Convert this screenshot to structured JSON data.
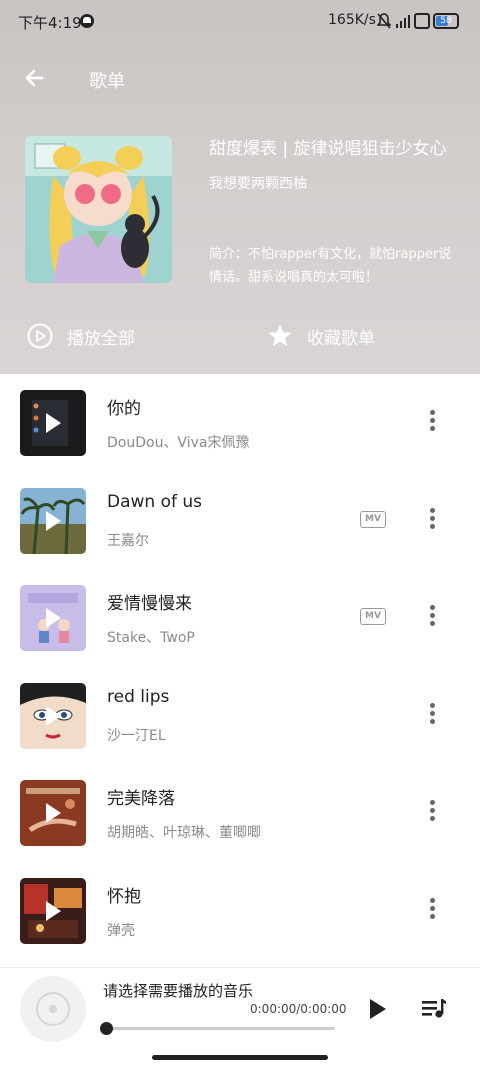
{
  "status_bar": {
    "time": "下午4:19",
    "net_speed": "165K/s",
    "battery": "58"
  },
  "header": {
    "title": "歌单",
    "back_icon": "arrow-left-icon"
  },
  "playlist": {
    "title": "甜度爆表 | 旋律说唱狙击少女心",
    "author": "我想要两颗西柚",
    "description": "简介：不怕rapper有文化，就怕rapper说情话。甜系说唱真的太可啦！"
  },
  "actions": {
    "play_all": "播放全部",
    "favorite": "收藏歌单"
  },
  "songs": [
    {
      "title": "你的",
      "artist": "DouDou、Viva宋佩豫",
      "mv": false
    },
    {
      "title": "Dawn of us",
      "artist": "王嘉尔",
      "mv": true
    },
    {
      "title": "爱情慢慢来",
      "artist": "Stake、TwoP",
      "mv": true
    },
    {
      "title": "red lips",
      "artist": "沙一汀EL",
      "mv": false
    },
    {
      "title": "完美降落",
      "artist": "胡期皓、叶琼琳、董唧唧",
      "mv": false
    },
    {
      "title": "怀抱",
      "artist": "弹壳",
      "mv": false
    }
  ],
  "mv_label": "MV",
  "player": {
    "now_playing": "请选择需要播放的音乐",
    "time": "0:00:00/0:00:00",
    "progress": 0
  },
  "colors": {
    "header_bg": "#d3cecc",
    "text_muted": "#8a8a8a"
  }
}
